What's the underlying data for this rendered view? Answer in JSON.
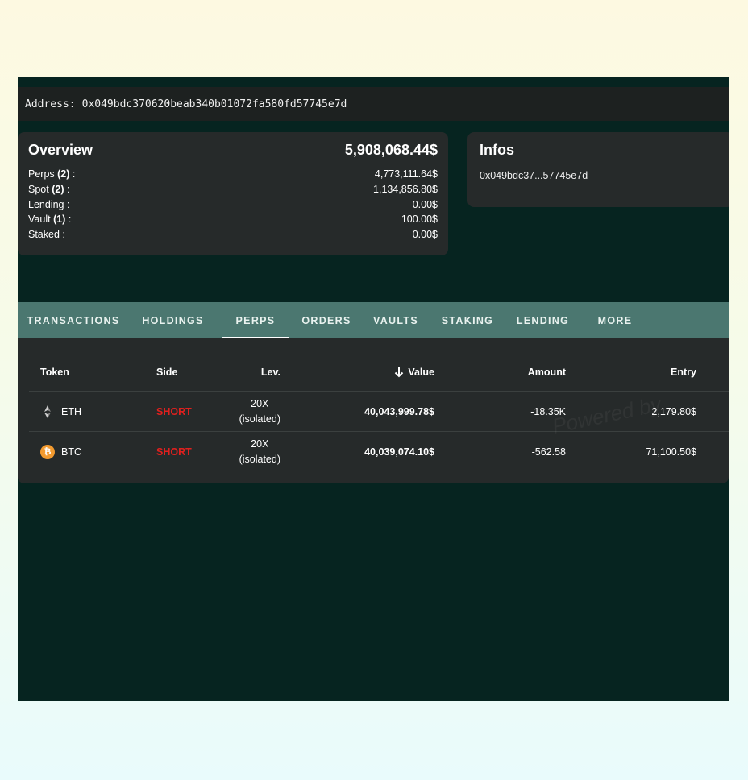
{
  "address_bar": {
    "label": "Address:",
    "value": "0x049bdc370620beab340b01072fa580fd57745e7d"
  },
  "overview": {
    "title": "Overview",
    "total": "5,908,068.44$",
    "rows": [
      {
        "label": "Perps",
        "count": "(2)",
        "suffix": " :",
        "value": "4,773,111.64$"
      },
      {
        "label": "Spot",
        "count": "(2)",
        "suffix": " :",
        "value": "1,134,856.80$"
      },
      {
        "label": "Lending",
        "count": "",
        "suffix": " :",
        "value": "0.00$"
      },
      {
        "label": "Vault",
        "count": "(1)",
        "suffix": " :",
        "value": "100.00$"
      },
      {
        "label": "Staked",
        "count": "",
        "suffix": " :",
        "value": "0.00$"
      }
    ]
  },
  "infos": {
    "title": "Infos",
    "short_address": "0x049bdc37...57745e7d"
  },
  "tabs": [
    {
      "label": "TRANSACTIONS",
      "active": false
    },
    {
      "label": "HOLDINGS",
      "active": false
    },
    {
      "label": "PERPS",
      "active": true
    },
    {
      "label": "ORDERS",
      "active": false
    },
    {
      "label": "VAULTS",
      "active": false
    },
    {
      "label": "STAKING",
      "active": false
    },
    {
      "label": "LENDING",
      "active": false
    },
    {
      "label": "MORE",
      "active": false
    }
  ],
  "table": {
    "headers": {
      "token": "Token",
      "side": "Side",
      "lev": "Lev.",
      "value": "Value",
      "amount": "Amount",
      "entry": "Entry"
    },
    "sort_icon": "arrow-down-icon",
    "rows": [
      {
        "token": "ETH",
        "icon": "eth-icon",
        "side": "SHORT",
        "lev": "20X",
        "lev_mode": "(isolated)",
        "value": "40,043,999.78$",
        "amount": "-18.35K",
        "entry": "2,179.80$"
      },
      {
        "token": "BTC",
        "icon": "btc-icon",
        "side": "SHORT",
        "lev": "20X",
        "lev_mode": "(isolated)",
        "value": "40,039,074.10$",
        "amount": "-562.58",
        "entry": "71,100.50$"
      }
    ]
  },
  "watermark": "Powered by",
  "colors": {
    "app_bg": "#062420",
    "card_bg": "#262a2a",
    "tabs_bg": "#4b7770",
    "short": "#e0201e",
    "btc": "#f29a2f"
  }
}
